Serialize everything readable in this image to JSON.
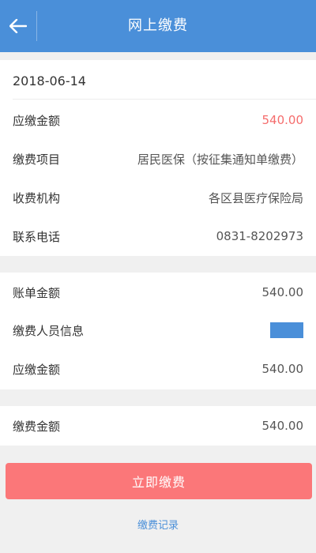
{
  "header": {
    "title": "网上缴费",
    "back_icon": "arrow-left-icon"
  },
  "bill": {
    "date": "2018-06-14",
    "rows": [
      {
        "label": "应缴金额",
        "value": "540.00"
      },
      {
        "label": "缴费项目",
        "value": "居民医保（按征集通知单缴费）"
      },
      {
        "label": "收费机构",
        "value": "各区县医疗保险局"
      },
      {
        "label": "联系电话",
        "value": "0831-8202973"
      }
    ]
  },
  "summary": {
    "rows": [
      {
        "label": "账单金额",
        "value": "540.00"
      },
      {
        "label": "缴费人员信息"
      },
      {
        "label": "应缴金额",
        "value": "540.00"
      }
    ]
  },
  "payment": {
    "label": "缴费金额",
    "value": "540.00"
  },
  "actions": {
    "pay_now": "立即缴费",
    "records": "缴费记录"
  },
  "colors": {
    "primary": "#4a8fd9",
    "danger": "#f56c6c",
    "button": "#fb7779",
    "background": "#f0f0f0"
  }
}
